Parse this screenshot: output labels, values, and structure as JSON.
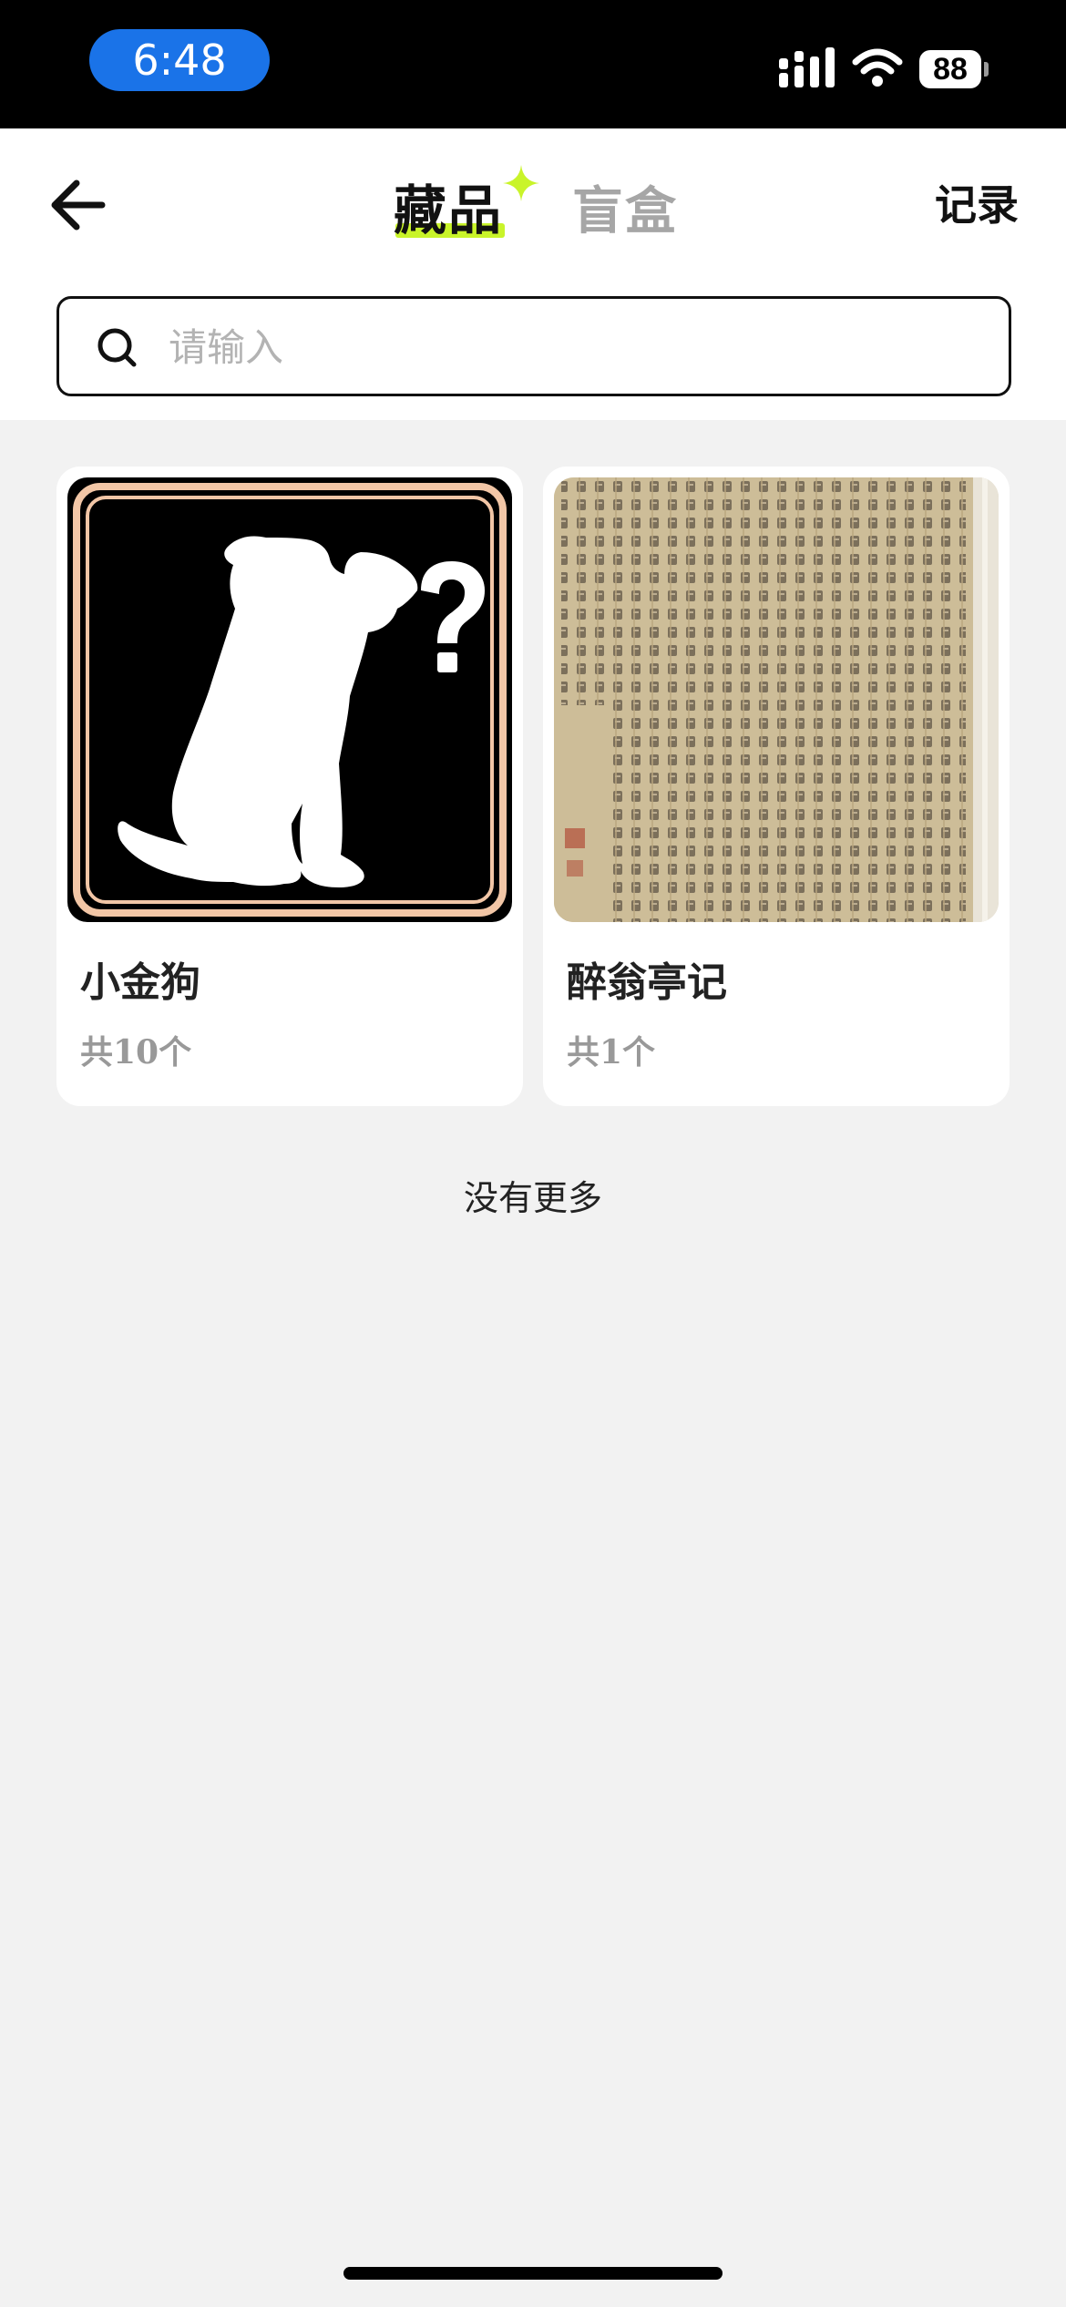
{
  "status_bar": {
    "time": "6:48",
    "battery": "88",
    "signal_icon": "cellular-signal-icon",
    "wifi_icon": "wifi-icon",
    "accent_color": "#1a73e8"
  },
  "header": {
    "back_icon": "arrow-left-icon",
    "tabs": [
      {
        "label": "藏品",
        "active": true
      },
      {
        "label": "盲盒",
        "active": false
      }
    ],
    "record_label": "记录",
    "highlight_color": "#c9f42a"
  },
  "search": {
    "placeholder": "请输入",
    "value": ""
  },
  "collections": [
    {
      "title": "小金狗",
      "count": "共10个",
      "image": "mystery-dog-silhouette"
    },
    {
      "title": "醉翁亭记",
      "count": "共1个",
      "image": "calligraphy-scroll"
    }
  ],
  "footer": {
    "no_more": "没有更多"
  }
}
